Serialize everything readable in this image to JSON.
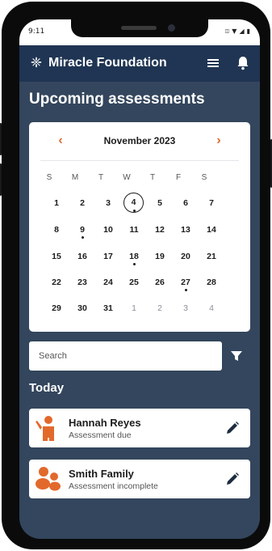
{
  "status_bar": {
    "time": "9:11"
  },
  "app": {
    "name": "Miracle Foundation",
    "logo_icon": "snowflake-icon"
  },
  "page": {
    "title": "Upcoming assessments"
  },
  "calendar": {
    "month_label": "November 2023",
    "weekdays": [
      "S",
      "M",
      "T",
      "W",
      "T",
      "F",
      "S"
    ],
    "weeks": [
      [
        "1",
        "2",
        "3",
        "4",
        "5",
        "6",
        "7"
      ],
      [
        "8",
        "9",
        "10",
        "11",
        "12",
        "13",
        "14"
      ],
      [
        "15",
        "16",
        "17",
        "18",
        "19",
        "20",
        "21"
      ],
      [
        "22",
        "23",
        "24",
        "25",
        "26",
        "27",
        "28"
      ],
      [
        "29",
        "30",
        "31",
        "1",
        "2",
        "3",
        "4"
      ]
    ],
    "selected_day": "4",
    "days_with_events": [
      "4",
      "9",
      "18",
      "27"
    ]
  },
  "search": {
    "placeholder": "Search"
  },
  "section": {
    "today_label": "Today"
  },
  "assessments": [
    {
      "name": "Hannah Reyes",
      "status": "Assessment due",
      "avatar_icon": "person-icon"
    },
    {
      "name": "Smith Family",
      "status": "Assessment incomplete",
      "avatar_icon": "family-icon"
    }
  ],
  "colors": {
    "app_bar": "#1f3553",
    "background": "#33465d",
    "accent": "#e2692c"
  }
}
